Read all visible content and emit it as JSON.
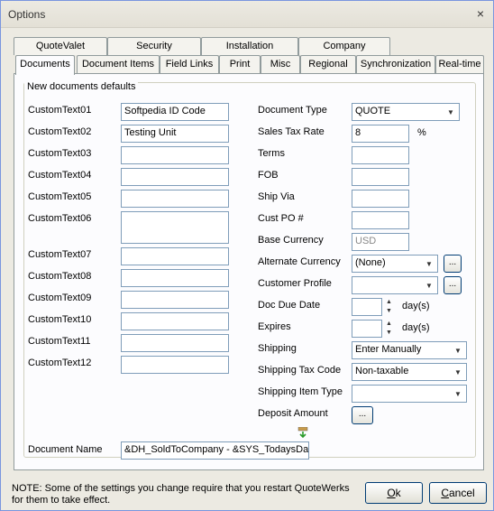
{
  "window": {
    "title": "Options"
  },
  "tabs_row1": [
    "QuoteValet",
    "Security",
    "Installation",
    "Company"
  ],
  "tabs_row2": [
    "Documents",
    "Document Items",
    "Field Links",
    "Print",
    "Misc",
    "Regional",
    "Synchronization",
    "Real-time"
  ],
  "group_title": "New documents defaults",
  "custom": {
    "labels": [
      "CustomText01",
      "CustomText02",
      "CustomText03",
      "CustomText04",
      "CustomText05",
      "CustomText06",
      "CustomText07",
      "CustomText08",
      "CustomText09",
      "CustomText10",
      "CustomText11",
      "CustomText12"
    ],
    "values": [
      "Softpedia ID Code",
      "Testing Unit",
      "",
      "",
      "",
      "",
      "",
      "",
      "",
      "",
      "",
      ""
    ]
  },
  "right": {
    "document_type_label": "Document Type",
    "document_type_value": "QUOTE",
    "sales_tax_label": "Sales Tax Rate",
    "sales_tax_value": "8",
    "percent": "%",
    "terms_label": "Terms",
    "fob_label": "FOB",
    "ship_via_label": "Ship Via",
    "cust_po_label": "Cust PO #",
    "base_currency_label": "Base Currency",
    "base_currency_value": "USD",
    "alt_currency_label": "Alternate Currency",
    "alt_currency_value": "(None)",
    "customer_profile_label": "Customer Profile",
    "doc_due_label": "Doc Due Date",
    "days": "day(s)",
    "expires_label": "Expires",
    "shipping_label": "Shipping",
    "shipping_value": "Enter Manually",
    "shipping_tax_label": "Shipping Tax Code",
    "shipping_tax_value": "Non-taxable",
    "shipping_item_label": "Shipping Item Type",
    "deposit_label": "Deposit Amount",
    "ellipsis": "..."
  },
  "document_name": {
    "label": "Document Name",
    "value": "&DH_SoldToCompany - &SYS_TodaysDate"
  },
  "note": "NOTE: Some of the settings you change require that you restart QuoteWerks for them to take effect.",
  "buttons": {
    "ok_u": "O",
    "ok_rest": "k",
    "cancel_u": "C",
    "cancel_rest": "ancel"
  },
  "icons": {
    "close": "×",
    "dropdown": "▼",
    "up": "▲",
    "down": "▼"
  }
}
